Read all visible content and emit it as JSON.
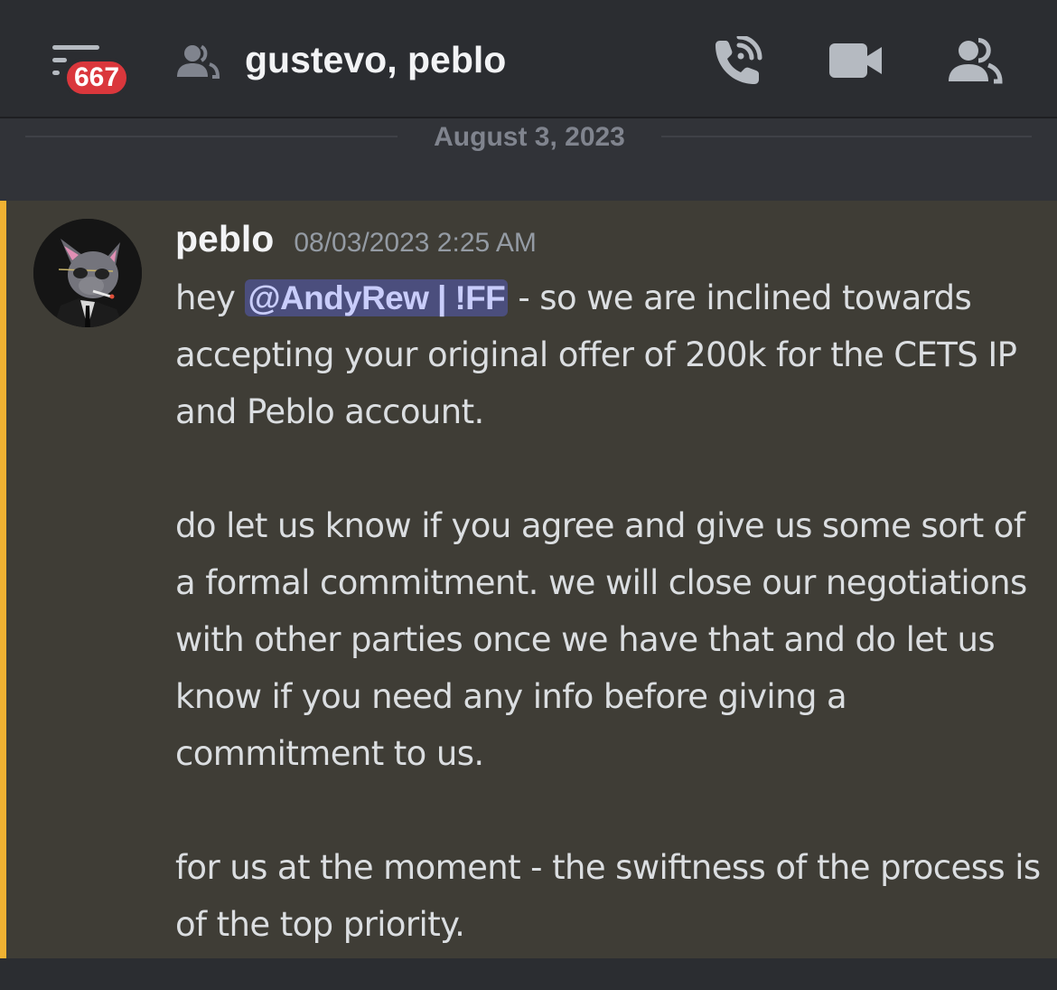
{
  "header": {
    "unread_badge": "667",
    "channel_title": "gustevo, peblo",
    "icons": {
      "menu": "hamburger-menu-icon",
      "dm": "group-dm-icon",
      "call": "phone-call-icon",
      "video": "video-camera-icon",
      "members": "members-icon"
    }
  },
  "divider": {
    "date": "August 3, 2023"
  },
  "message": {
    "author": "peblo",
    "timestamp": "08/03/2023 2:25 AM",
    "highlight_color": "#f0b232",
    "line1_prefix": "hey ",
    "mention": "@AndyRew | !FF",
    "line1_suffix": " - so we are inclined towards accepting your original offer of 200k for the CETS IP and Peblo account.",
    "paragraph2": "do let us know if you agree and give us some sort of a formal commitment. we will close our negotiations with other parties once we have that and do let us know if you need any info before giving a commitment to us.",
    "paragraph3": "for us at the moment - the swiftness of the process is of the top priority."
  },
  "colors": {
    "background": "#313338",
    "header": "#2b2d31",
    "badge": "#da373c",
    "mention_bg": "#4b4e7d",
    "message_highlight_bg": "#3f3d36"
  }
}
